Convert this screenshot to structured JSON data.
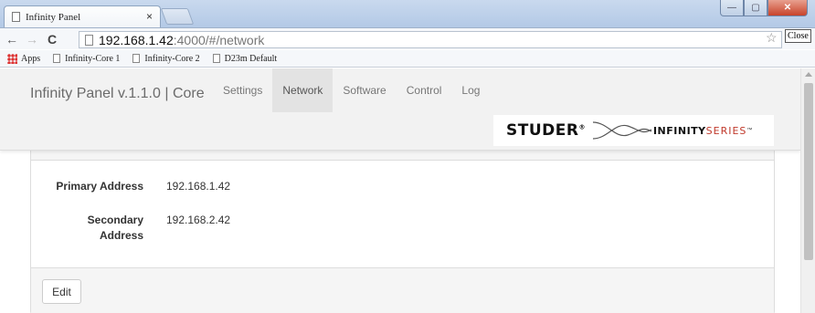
{
  "browser": {
    "tab_title": "Infinity Panel",
    "tab_close": "×",
    "url_host": "192.168.1.42",
    "url_rest": ":4000/#/network",
    "close_chip": "Close",
    "window_buttons": {
      "minimize": "—",
      "maximize": "▢",
      "close": "✕"
    },
    "bookmarks": [
      "Apps",
      "Infinity-Core 1",
      "Infinity-Core 2",
      "D23m Default"
    ]
  },
  "app": {
    "brand": "Infinity Panel v.1.1.0 | Core",
    "nav": [
      {
        "label": "Settings",
        "active": false
      },
      {
        "label": "Network",
        "active": true
      },
      {
        "label": "Software",
        "active": false
      },
      {
        "label": "Control",
        "active": false
      },
      {
        "label": "Log",
        "active": false
      }
    ],
    "logo": {
      "studer": "STUDER",
      "reg": "®",
      "infinity": "INFINITY",
      "series": "SERIES",
      "tm": "™"
    }
  },
  "network": {
    "primary_label": "Primary Address",
    "primary_value": "192.168.1.42",
    "secondary_label_line1": "Secondary",
    "secondary_label_line2": "Address",
    "secondary_value": "192.168.2.42",
    "edit_label": "Edit"
  }
}
